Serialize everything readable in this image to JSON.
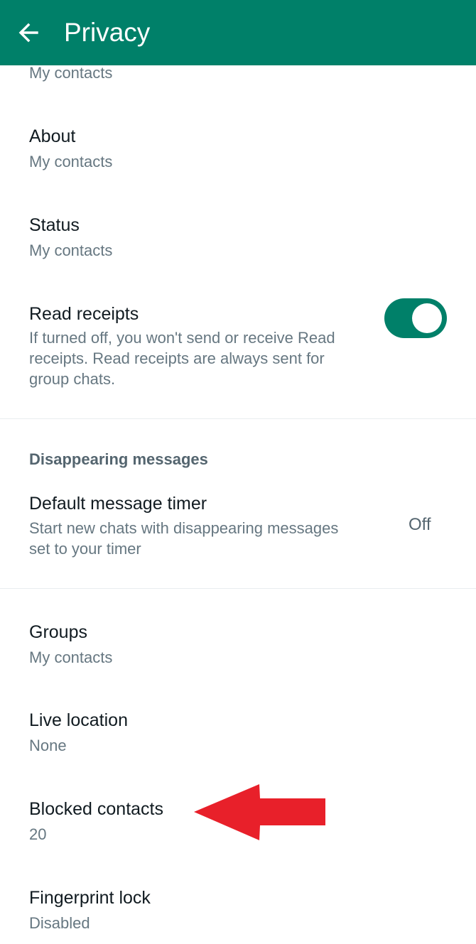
{
  "header": {
    "title": "Privacy",
    "back_icon": "arrow-left-icon",
    "background": "#008069"
  },
  "partial_item": {
    "subtitle": "My contacts"
  },
  "items": {
    "about": {
      "title": "About",
      "subtitle": "My contacts"
    },
    "status": {
      "title": "Status",
      "subtitle": "My contacts"
    },
    "read_receipts": {
      "title": "Read receipts",
      "description_line1": "If turned off, you won't send or receive Read",
      "description_line2": "receipts. Read receipts are always sent for",
      "description_line3": "group chats.",
      "enabled": true
    },
    "default_timer": {
      "title": "Default message timer",
      "description_line1": "Start new chats with disappearing messages",
      "description_line2": "set to your timer",
      "value": "Off"
    },
    "groups": {
      "title": "Groups",
      "subtitle": "My contacts"
    },
    "live_location": {
      "title": "Live location",
      "subtitle": "None"
    },
    "blocked_contacts": {
      "title": "Blocked contacts",
      "subtitle": "20"
    },
    "fingerprint_lock": {
      "title": "Fingerprint lock",
      "subtitle": "Disabled"
    }
  },
  "sections": {
    "disappearing": "Disappearing messages"
  },
  "annotation": {
    "arrow_icon": "red-arrow-icon",
    "color": "#e8202a"
  },
  "colors": {
    "accent": "#008069",
    "primary_text": "#111b21",
    "secondary_text": "#667781"
  }
}
